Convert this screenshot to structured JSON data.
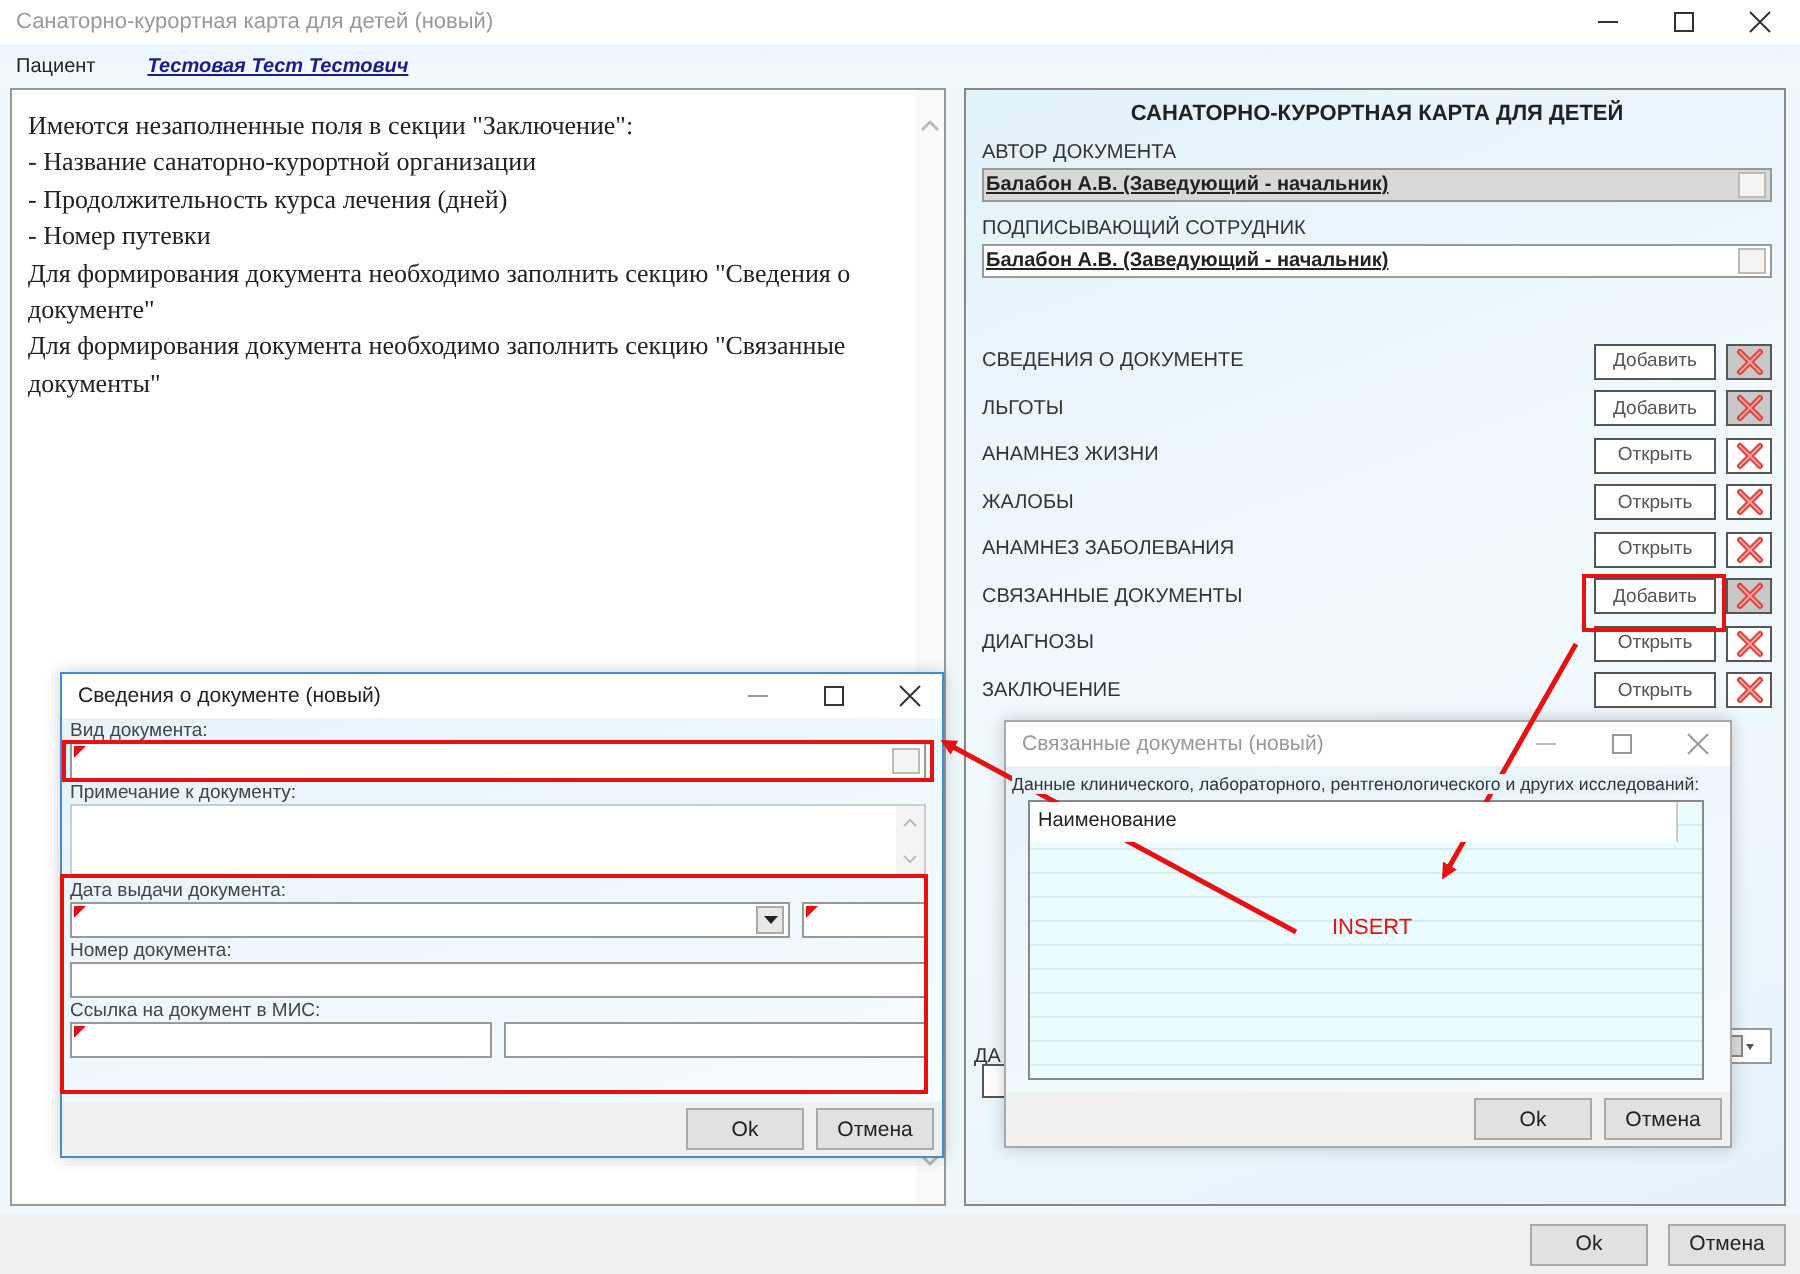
{
  "window": {
    "title": "Санаторно-курортная карта для детей (новый)"
  },
  "patient": {
    "label": "Пациент",
    "name": "Тестовая Тест Тестович"
  },
  "messages": [
    "Имеются незаполненные поля в секции \"Заключение\":",
    "- Название санаторно-курортной организации",
    "- Продолжительность курса лечения (дней)",
    "- Номер путевки",
    "Для формирования документа необходимо заполнить секцию \"Сведения о документе\"",
    "Для формирования документа необходимо заполнить секцию \"Связанные документы\""
  ],
  "card": {
    "heading": "САНАТОРНО-КУРОРТНАЯ КАРТА ДЛЯ ДЕТЕЙ",
    "people": [
      {
        "label": "АВТОР ДОКУМЕНТА",
        "value": "Балабон А.В. (Заведующий - начальник)",
        "disabled": true
      },
      {
        "label": "ПОДПИСЫВАЮЩИЙ СОТРУДНИК",
        "value": "Балабон А.В. (Заведующий - начальник)",
        "disabled": false
      }
    ],
    "sections": [
      {
        "label": "СВЕДЕНИЯ О ДОКУМЕНТЕ",
        "button": "Добавить",
        "delete_disabled": true
      },
      {
        "label": "ЛЬГОТЫ",
        "button": "Добавить",
        "delete_disabled": true
      },
      {
        "label": "АНАМНЕЗ ЖИЗНИ",
        "button": "Открыть",
        "delete_disabled": false
      },
      {
        "label": "ЖАЛОБЫ",
        "button": "Открыть",
        "delete_disabled": false
      },
      {
        "label": "АНАМНЕЗ ЗАБОЛЕВАНИЯ",
        "button": "Открыть",
        "delete_disabled": false
      },
      {
        "label": "СВЯЗАННЫЕ ДОКУМЕНТЫ",
        "button": "Добавить",
        "delete_disabled": true
      },
      {
        "label": "ДИАГНОЗЫ",
        "button": "Открыть",
        "delete_disabled": false
      },
      {
        "label": "ЗАКЛЮЧЕНИЕ",
        "button": "Открыть",
        "delete_disabled": false
      }
    ],
    "partial_label": "ДА"
  },
  "footer": {
    "ok": "Ok",
    "cancel": "Отмена"
  },
  "info_dialog": {
    "title": "Сведения о документе (новый)",
    "active": true,
    "fields": [
      {
        "label": "Вид документа:",
        "inputs": [
          {
            "kind": "lookup",
            "required": true
          }
        ]
      },
      {
        "label": "Примечание к документу:",
        "inputs": [
          {
            "kind": "memo",
            "required": false
          }
        ]
      },
      {
        "label": "Дата выдачи документа:",
        "inputs": [
          {
            "kind": "dropdown",
            "required": true
          },
          {
            "kind": "short",
            "required": true
          }
        ]
      },
      {
        "label": "Номер документа:",
        "inputs": [
          {
            "kind": "text",
            "required": false
          }
        ]
      },
      {
        "label": "Ссылка на документ в МИС:",
        "inputs": [
          {
            "kind": "text",
            "required": true
          },
          {
            "kind": "text",
            "required": false
          }
        ]
      }
    ],
    "ok": "Ok",
    "cancel": "Отмена"
  },
  "related_dialog": {
    "title": "Связанные документы (новый)",
    "active": false,
    "caption": "Данные клинического, лабораторного, рентгенологического и других исследований:",
    "column": "Наименование",
    "ok": "Ok",
    "cancel": "Отмена"
  },
  "annotation": {
    "text": "INSERT"
  }
}
